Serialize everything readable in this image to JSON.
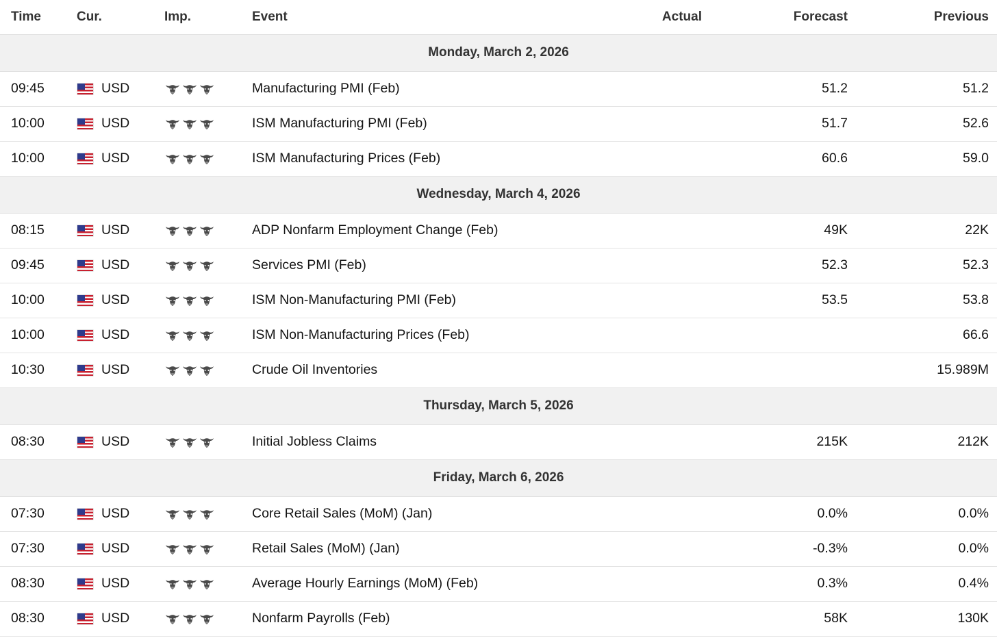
{
  "columns": {
    "time": "Time",
    "currency": "Cur.",
    "importance": "Imp.",
    "event": "Event",
    "actual": "Actual",
    "forecast": "Forecast",
    "previous": "Previous"
  },
  "importance_icon": "bull-icon",
  "flag_icon": "us-flag-icon",
  "days": [
    {
      "label": "Monday, March 2, 2026",
      "events": [
        {
          "time": "09:45",
          "currency": "USD",
          "importance": 3,
          "event": "Manufacturing PMI (Feb)",
          "actual": "",
          "forecast": "51.2",
          "previous": "51.2"
        },
        {
          "time": "10:00",
          "currency": "USD",
          "importance": 3,
          "event": "ISM Manufacturing PMI (Feb)",
          "actual": "",
          "forecast": "51.7",
          "previous": "52.6"
        },
        {
          "time": "10:00",
          "currency": "USD",
          "importance": 3,
          "event": "ISM Manufacturing Prices (Feb)",
          "actual": "",
          "forecast": "60.6",
          "previous": "59.0"
        }
      ]
    },
    {
      "label": "Wednesday, March 4, 2026",
      "events": [
        {
          "time": "08:15",
          "currency": "USD",
          "importance": 3,
          "event": "ADP Nonfarm Employment Change (Feb)",
          "actual": "",
          "forecast": "49K",
          "previous": "22K"
        },
        {
          "time": "09:45",
          "currency": "USD",
          "importance": 3,
          "event": "Services PMI (Feb)",
          "actual": "",
          "forecast": "52.3",
          "previous": "52.3"
        },
        {
          "time": "10:00",
          "currency": "USD",
          "importance": 3,
          "event": "ISM Non-Manufacturing PMI (Feb)",
          "actual": "",
          "forecast": "53.5",
          "previous": "53.8"
        },
        {
          "time": "10:00",
          "currency": "USD",
          "importance": 3,
          "event": "ISM Non-Manufacturing Prices (Feb)",
          "actual": "",
          "forecast": "",
          "previous": "66.6"
        },
        {
          "time": "10:30",
          "currency": "USD",
          "importance": 3,
          "event": "Crude Oil Inventories",
          "actual": "",
          "forecast": "",
          "previous": "15.989M"
        }
      ]
    },
    {
      "label": "Thursday, March 5, 2026",
      "events": [
        {
          "time": "08:30",
          "currency": "USD",
          "importance": 3,
          "event": "Initial Jobless Claims",
          "actual": "",
          "forecast": "215K",
          "previous": "212K"
        }
      ]
    },
    {
      "label": "Friday, March 6, 2026",
      "events": [
        {
          "time": "07:30",
          "currency": "USD",
          "importance": 3,
          "event": "Core Retail Sales (MoM) (Jan)",
          "actual": "",
          "forecast": "0.0%",
          "previous": "0.0%"
        },
        {
          "time": "07:30",
          "currency": "USD",
          "importance": 3,
          "event": "Retail Sales (MoM) (Jan)",
          "actual": "",
          "forecast": "-0.3%",
          "previous": "0.0%"
        },
        {
          "time": "08:30",
          "currency": "USD",
          "importance": 3,
          "event": "Average Hourly Earnings (MoM) (Feb)",
          "actual": "",
          "forecast": "0.3%",
          "previous": "0.4%"
        },
        {
          "time": "08:30",
          "currency": "USD",
          "importance": 3,
          "event": "Nonfarm Payrolls (Feb)",
          "actual": "",
          "forecast": "58K",
          "previous": "130K"
        }
      ]
    }
  ]
}
